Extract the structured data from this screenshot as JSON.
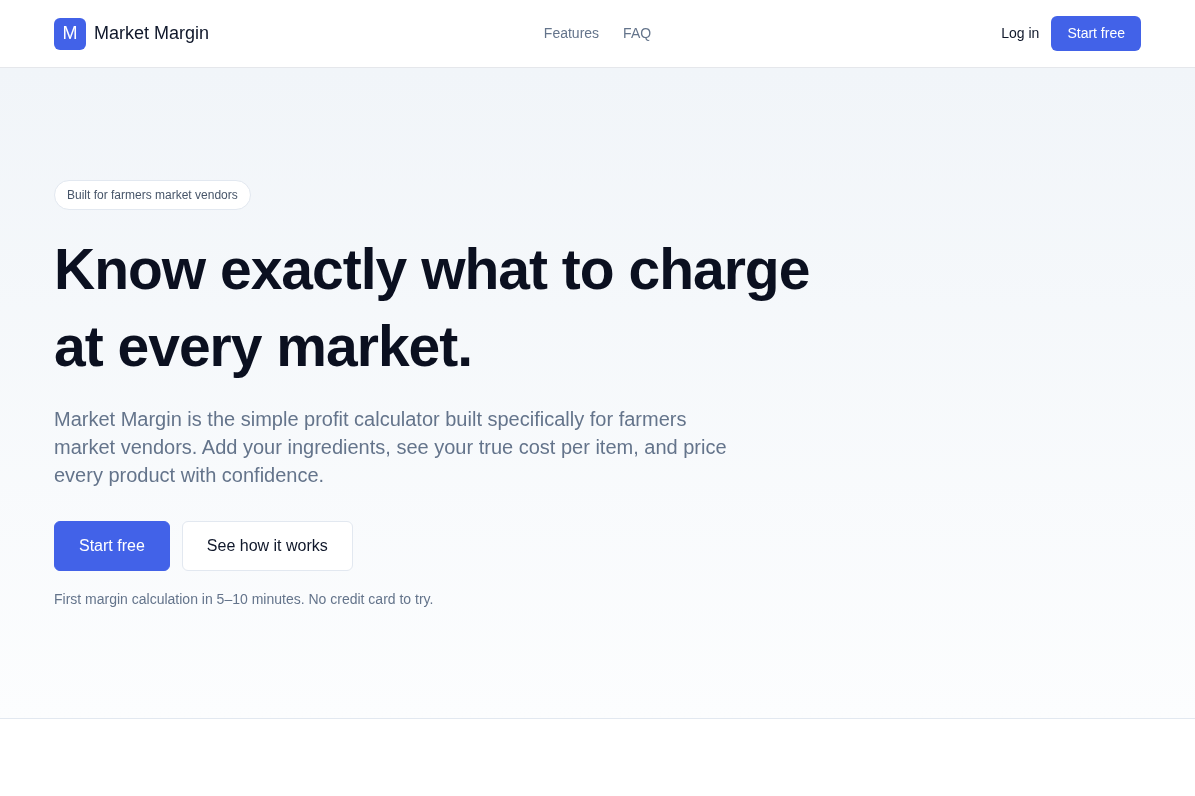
{
  "header": {
    "logo": {
      "mark": "M",
      "name": "Market Margin"
    },
    "nav": [
      {
        "label": "Features"
      },
      {
        "label": "FAQ"
      }
    ],
    "login": "Log in",
    "cta": "Start free"
  },
  "hero": {
    "badge": "Built for farmers market vendors",
    "headline": "Know exactly what to charge at every market.",
    "description": "Market Margin is the simple profit calculator built specifically for farmers market vendors. Add your ingredients, see your true cost per item, and price every product with confidence.",
    "buttons": [
      {
        "label": "Start free",
        "kind": "primary"
      },
      {
        "label": "See how it works",
        "kind": "secondary"
      }
    ],
    "footnote": "First margin calculation in 5–10 minutes. No credit card to try."
  }
}
